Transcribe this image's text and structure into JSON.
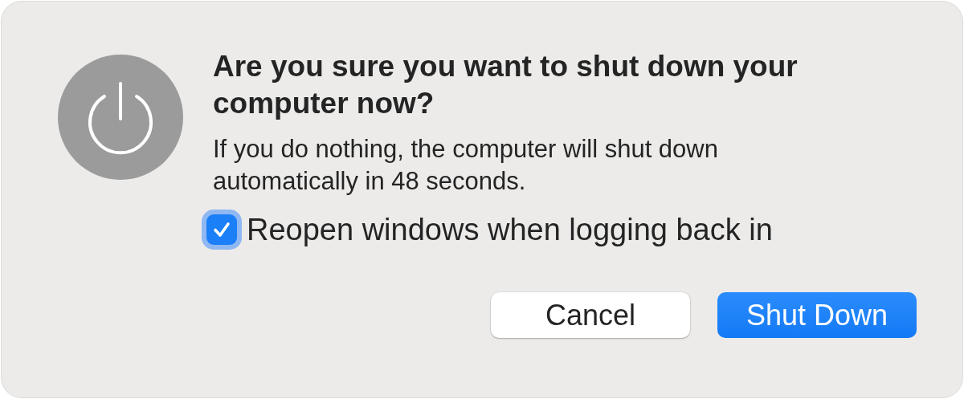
{
  "dialog": {
    "title": "Are you sure you want to shut down your computer now?",
    "message": "If you do nothing, the computer will shut down automatically in 48 seconds.",
    "checkbox": {
      "label": "Reopen windows when logging back in",
      "checked": true
    },
    "buttons": [
      {
        "label": "Cancel",
        "kind": "secondary"
      },
      {
        "label": "Shut Down",
        "kind": "primary"
      }
    ]
  }
}
